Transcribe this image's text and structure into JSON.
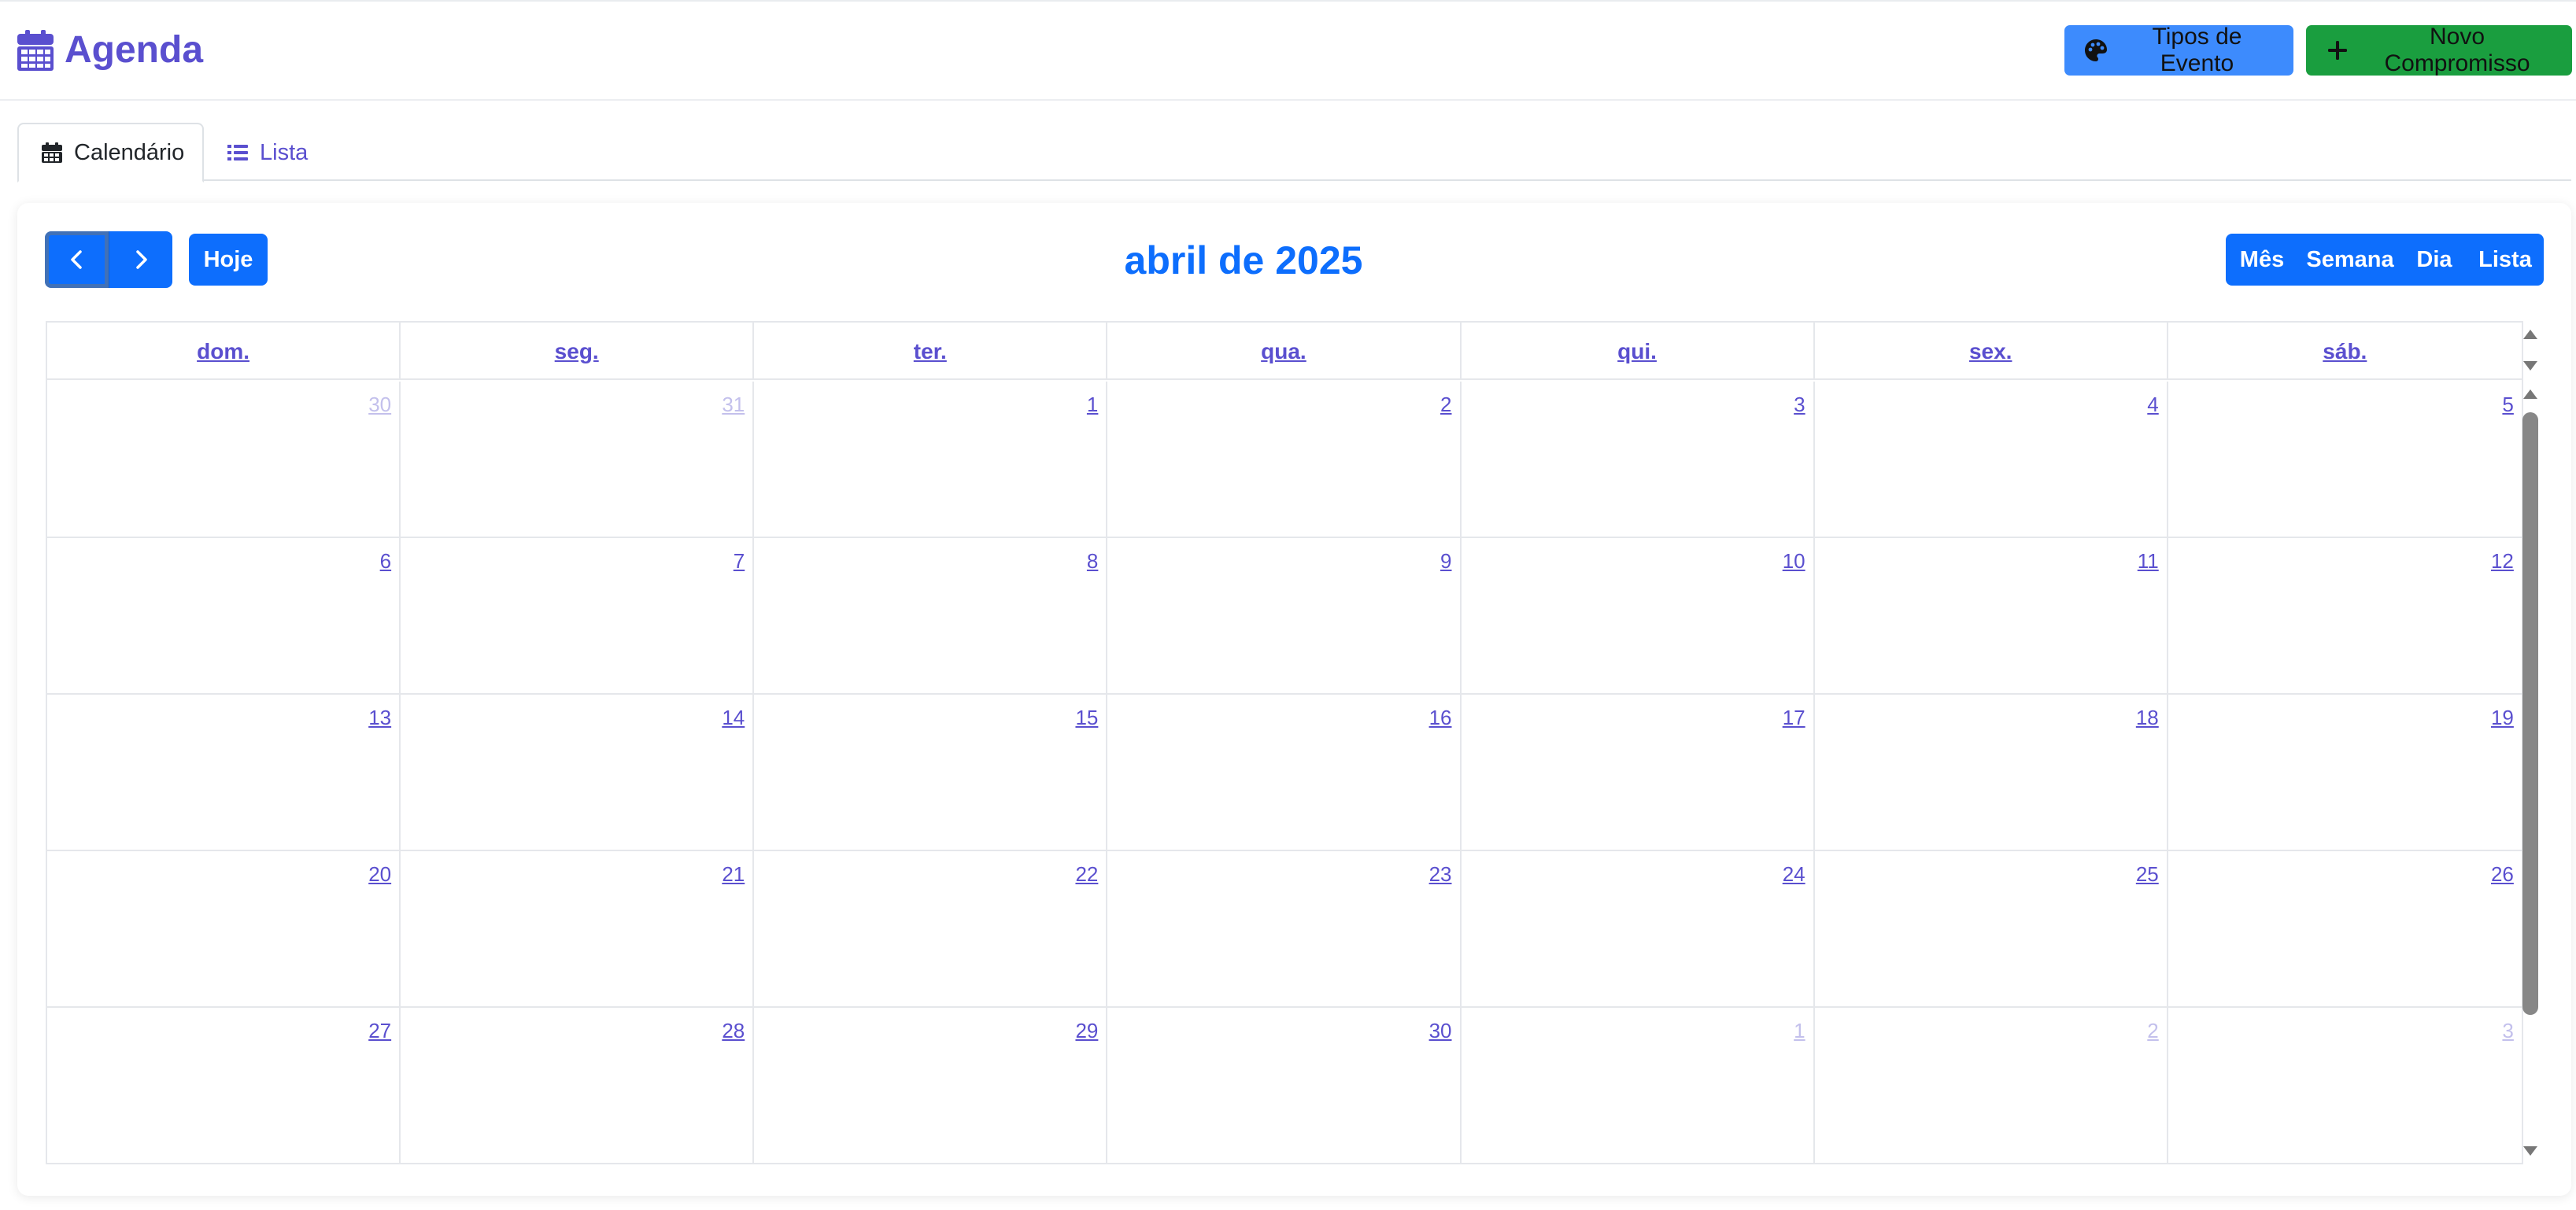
{
  "app": {
    "title": "Agenda",
    "icon": "calendar-icon"
  },
  "header_buttons": {
    "types": {
      "label": "Tipos de Evento",
      "icon": "palette-icon",
      "color": "#3d8bfd"
    },
    "new": {
      "label": "Novo Compromisso",
      "icon": "plus-icon",
      "color": "#1a9e3f"
    }
  },
  "tabs": [
    {
      "label": "Calendário",
      "icon": "calendar-icon",
      "active": true
    },
    {
      "label": "Lista",
      "icon": "list-icon",
      "active": false
    }
  ],
  "toolbar": {
    "prev_icon": "chevron-left-icon",
    "next_icon": "chevron-right-icon",
    "today_label": "Hoje",
    "title": "abril de 2025",
    "views": [
      "Mês",
      "Semana",
      "Dia",
      "Lista"
    ]
  },
  "weekdays": [
    "dom.",
    "seg.",
    "ter.",
    "qua.",
    "qui.",
    "sex.",
    "sáb."
  ],
  "weeks": [
    [
      {
        "d": "30",
        "other": true
      },
      {
        "d": "31",
        "other": true
      },
      {
        "d": "1"
      },
      {
        "d": "2"
      },
      {
        "d": "3"
      },
      {
        "d": "4"
      },
      {
        "d": "5"
      }
    ],
    [
      {
        "d": "6"
      },
      {
        "d": "7"
      },
      {
        "d": "8"
      },
      {
        "d": "9"
      },
      {
        "d": "10"
      },
      {
        "d": "11"
      },
      {
        "d": "12"
      }
    ],
    [
      {
        "d": "13"
      },
      {
        "d": "14"
      },
      {
        "d": "15"
      },
      {
        "d": "16"
      },
      {
        "d": "17"
      },
      {
        "d": "18"
      },
      {
        "d": "19"
      }
    ],
    [
      {
        "d": "20"
      },
      {
        "d": "21"
      },
      {
        "d": "22"
      },
      {
        "d": "23"
      },
      {
        "d": "24"
      },
      {
        "d": "25"
      },
      {
        "d": "26"
      }
    ],
    [
      {
        "d": "27"
      },
      {
        "d": "28"
      },
      {
        "d": "29"
      },
      {
        "d": "30"
      },
      {
        "d": "1",
        "other": true
      },
      {
        "d": "2",
        "other": true
      },
      {
        "d": "3",
        "other": true
      }
    ]
  ],
  "colors": {
    "brand": "#5a4fcf",
    "primary": "#0d6efd"
  }
}
